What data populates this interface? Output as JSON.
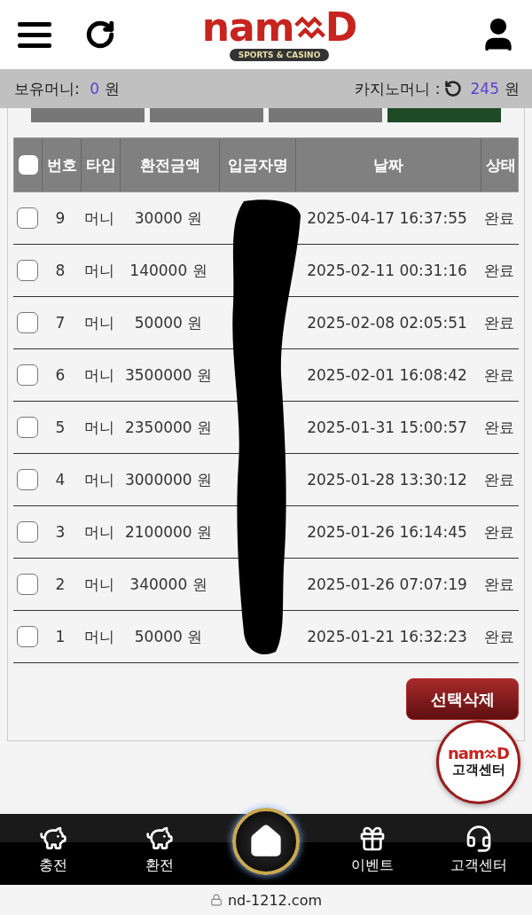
{
  "header": {
    "logo": {
      "wordmark": "nam",
      "wordmark_end": "D",
      "tagline": "SPORTS & CASINO"
    }
  },
  "balance_bar": {
    "held_label": "보유머니:",
    "held_value": "0",
    "held_unit": "원",
    "casino_label": "카지노머니 :",
    "casino_value": "245",
    "casino_unit": "원"
  },
  "tabs": [
    {
      "selected": false
    },
    {
      "selected": false
    },
    {
      "selected": false
    },
    {
      "selected": true
    }
  ],
  "table": {
    "header_checked": false,
    "columns": [
      "번호",
      "타입",
      "환전금액",
      "입금자명",
      "날짜",
      "상태"
    ],
    "rows": [
      {
        "checked": false,
        "no": "9",
        "type": "머니",
        "amount": "30000 원",
        "date": "2025-04-17 16:37:55",
        "status": "완료"
      },
      {
        "checked": false,
        "no": "8",
        "type": "머니",
        "amount": "140000 원",
        "date": "2025-02-11 00:31:16",
        "status": "완료"
      },
      {
        "checked": false,
        "no": "7",
        "type": "머니",
        "amount": "50000 원",
        "date": "2025-02-08 02:05:51",
        "status": "완료"
      },
      {
        "checked": false,
        "no": "6",
        "type": "머니",
        "amount": "3500000 원",
        "date": "2025-02-01 16:08:42",
        "status": "완료"
      },
      {
        "checked": false,
        "no": "5",
        "type": "머니",
        "amount": "2350000 원",
        "date": "2025-01-31 15:00:57",
        "status": "완료"
      },
      {
        "checked": false,
        "no": "4",
        "type": "머니",
        "amount": "3000000 원",
        "date": "2025-01-28 13:30:12",
        "status": "완료"
      },
      {
        "checked": false,
        "no": "3",
        "type": "머니",
        "amount": "2100000 원",
        "date": "2025-01-26 16:14:45",
        "status": "완료"
      },
      {
        "checked": false,
        "no": "2",
        "type": "머니",
        "amount": "340000 원",
        "date": "2025-01-26 07:07:19",
        "status": "완료"
      },
      {
        "checked": false,
        "no": "1",
        "type": "머니",
        "amount": "50000 원",
        "date": "2025-01-21 16:32:23",
        "status": "완료"
      }
    ]
  },
  "delete_button": "선택삭제",
  "floating_badge": {
    "wordmark": "nam",
    "wordmark_end": "D",
    "label": "고객센터"
  },
  "bottom_nav": [
    {
      "kind": "deposit",
      "label": "충전"
    },
    {
      "kind": "withdraw",
      "label": "환전"
    },
    {
      "kind": "home"
    },
    {
      "kind": "event",
      "label": "이벤트"
    },
    {
      "kind": "support",
      "label": "고객센터"
    }
  ],
  "url_bar": {
    "url": "nd-1212.com"
  }
}
